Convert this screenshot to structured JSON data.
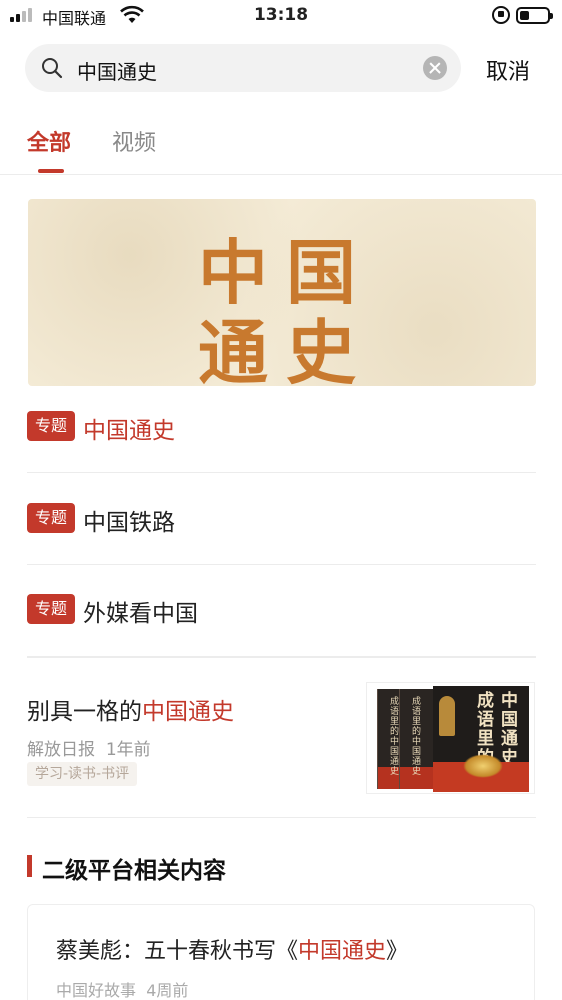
{
  "status_bar": {
    "carrier": "中国联通",
    "time": "13:18",
    "battery_level": 0.35
  },
  "search": {
    "query": "中国通史",
    "cancel_label": "取消"
  },
  "tabs": [
    {
      "label": "全部",
      "active": true
    },
    {
      "label": "视频",
      "active": false
    }
  ],
  "banner": {
    "chars": [
      "中",
      "国",
      "通",
      "史"
    ]
  },
  "specials": [
    {
      "tag": "专题",
      "title": "中国通史",
      "highlighted": true
    },
    {
      "tag": "专题",
      "title": "中国铁路",
      "highlighted": false
    },
    {
      "tag": "专题",
      "title": "外媒看中国",
      "highlighted": false
    }
  ],
  "article": {
    "title_prefix": "别具一格的",
    "title_highlight": "中国通史",
    "source": "解放日报",
    "time": "1年前",
    "category": "学习-读书-书评",
    "thumbnail": {
      "book_spine_text": "成语里的中国通史",
      "cover_col1": "成语里的",
      "cover_col2": "中国通史"
    }
  },
  "section": {
    "title": "二级平台相关内容"
  },
  "card": {
    "title_prefix": "蔡美彪：五十春秋书写《",
    "title_highlight": "中国通史",
    "title_suffix": "》",
    "source": "中国好故事",
    "time": "4周前"
  },
  "colors": {
    "accent": "#c3392b",
    "banner_bg": "#f4ebd6",
    "banner_text": "#c8792e"
  }
}
